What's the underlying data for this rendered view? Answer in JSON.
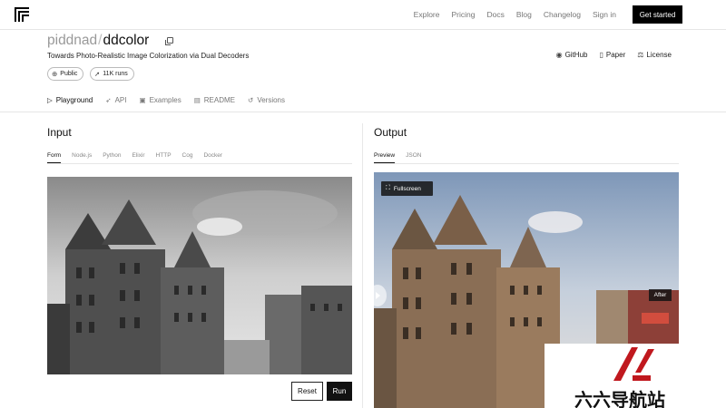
{
  "nav": {
    "links": [
      "Explore",
      "Pricing",
      "Docs",
      "Blog",
      "Changelog",
      "Sign in"
    ],
    "cta": "Get started"
  },
  "model": {
    "owner": "piddnad",
    "separator": "/",
    "name": "ddcolor",
    "description": "Towards Photo-Realistic Image Colorization via Dual Decoders",
    "badges": [
      {
        "icon": "globe-icon",
        "label": "Public"
      },
      {
        "icon": "rocket-icon",
        "label": "11K runs"
      }
    ],
    "refs": [
      {
        "icon": "github-icon",
        "label": "GitHub"
      },
      {
        "icon": "document-icon",
        "label": "Paper"
      },
      {
        "icon": "scale-icon",
        "label": "License"
      }
    ]
  },
  "tabs": [
    {
      "icon": "play-icon",
      "label": "Playground",
      "active": true
    },
    {
      "icon": "api-icon",
      "label": "API"
    },
    {
      "icon": "examples-icon",
      "label": "Examples"
    },
    {
      "icon": "readme-icon",
      "label": "README"
    },
    {
      "icon": "versions-icon",
      "label": "Versions"
    }
  ],
  "input": {
    "title": "Input",
    "subtabs": [
      "Form",
      "Node.js",
      "Python",
      "Elixir",
      "HTTP",
      "Cog",
      "Docker"
    ],
    "active_subtab": "Form",
    "reset_label": "Reset",
    "run_label": "Run"
  },
  "output": {
    "title": "Output",
    "subtabs": [
      "Preview",
      "JSON"
    ],
    "active_subtab": "Preview",
    "fullscreen_label": "Fullscreen",
    "after_label": "After"
  },
  "watermark": {
    "text": "六六导航站",
    "mark_color": "#c0181e"
  },
  "colors": {
    "accent": "#000000",
    "border": "#e6e6e6"
  }
}
